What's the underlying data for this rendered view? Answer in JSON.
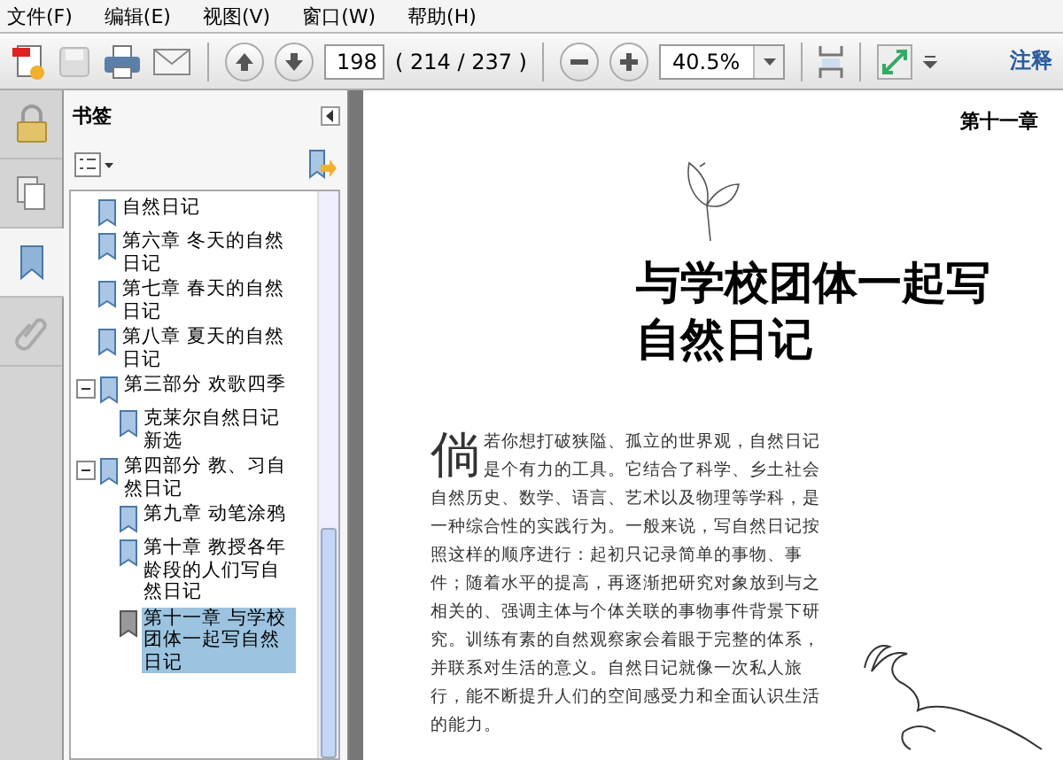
{
  "menu": [
    "文件(F)",
    "编辑(E)",
    "视图(V)",
    "窗口(W)",
    "帮助(H)"
  ],
  "toolbar": {
    "page_field": "198",
    "page_count": "( 214 / 237 )",
    "zoom_field": "40.5%",
    "comment_link": "注释"
  },
  "side_tabs": [
    {
      "kind": "lock",
      "selected": false
    },
    {
      "kind": "pages",
      "selected": false
    },
    {
      "kind": "bookmarks",
      "selected": true
    },
    {
      "kind": "attachments",
      "selected": false
    }
  ],
  "bookmarks_panel": {
    "title": "书签",
    "tree": [
      {
        "children": [
          {
            "label": "自然日记",
            "selected": false
          },
          {
            "label": "第六章  冬天的自然日记",
            "selected": false
          },
          {
            "label": "第七章  春天的自然日记",
            "selected": false
          },
          {
            "label": "第八章  夏天的自然日记",
            "selected": false
          }
        ]
      },
      {
        "label": "第三部分 欢歌四季",
        "expanded": true,
        "selected": false,
        "children": [
          {
            "label": "克莱尔自然日记新选",
            "selected": false
          }
        ]
      },
      {
        "label": "第四部分 教、习自然日记",
        "expanded": true,
        "selected": false,
        "children": [
          {
            "label": "第九章  动笔涂鸦",
            "selected": false
          },
          {
            "label": "第十章  教授各年龄段的人们写自然日记",
            "selected": false
          },
          {
            "label": "第十一章  与学校团体一起写自然日记",
            "selected": true
          }
        ]
      }
    ]
  },
  "page": {
    "running_head": "第十一章",
    "title": "与学校团体一起写自然日记",
    "drop_cap": "倘",
    "paragraph": "若你想打破狭隘、孤立的世界观，自然日记是个有力的工具。它结合了科学、乡土社会自然历史、数学、语言、艺术以及物理等学科，是一种综合性的实践行为。一般来说，写自然日记按照这样的顺序进行：起初只记录简单的事物、事件；随着水平的提高，再逐渐把研究对象放到与之相关的、强调主体与个体关联的事物事件背景下研究。训练有素的自然观察家会着眼于完整的体系，并联系对生活的意义。自然日记就像一次私人旅行，能不断提升人们的空间感受力和全面认识生活的能力。"
  }
}
